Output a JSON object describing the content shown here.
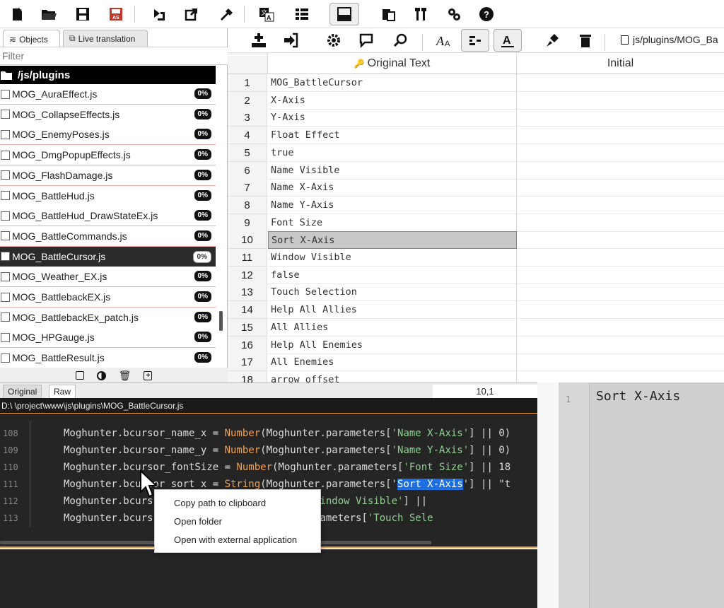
{
  "left_panel": {
    "tabs": [
      {
        "label": "Objects"
      },
      {
        "label": "Live translation"
      }
    ],
    "filter_placeholder": "Filter",
    "folder": "/js/plugins",
    "files": [
      {
        "name": "MOG_AuraEffect.js",
        "progress": "0%"
      },
      {
        "name": "MOG_CollapseEffects.js",
        "progress": "0%"
      },
      {
        "name": "MOG_EnemyPoses.js",
        "progress": "0%"
      },
      {
        "name": "MOG_DmgPopupEffects.js",
        "progress": "0%"
      },
      {
        "name": "MOG_FlashDamage.js",
        "progress": "0%"
      },
      {
        "name": "MOG_BattleHud.js",
        "progress": "0%"
      },
      {
        "name": "MOG_BattleHud_DrawStateEx.js",
        "progress": "0%"
      },
      {
        "name": "MOG_BattleCommands.js",
        "progress": "0%"
      },
      {
        "name": "MOG_BattleCursor.js",
        "progress": "0%",
        "selected": true
      },
      {
        "name": "MOG_Weather_EX.js",
        "progress": "0%"
      },
      {
        "name": "MOG_BattlebackEX.js",
        "progress": "0%"
      },
      {
        "name": "MOG_BattlebackEx_patch.js",
        "progress": "0%"
      },
      {
        "name": "MOG_HPGauge.js",
        "progress": "0%"
      },
      {
        "name": "MOG_BattleResult.js",
        "progress": "0%"
      }
    ]
  },
  "right_toolbar": {
    "path": "js/plugins/MOG_Ba"
  },
  "grid": {
    "columns": [
      "Original Text",
      "Initial"
    ],
    "rows": [
      {
        "n": "1",
        "text": "MOG_BattleCursor"
      },
      {
        "n": "2",
        "text": "X-Axis"
      },
      {
        "n": "3",
        "text": "Y-Axis"
      },
      {
        "n": "4",
        "text": "Float Effect"
      },
      {
        "n": "5",
        "text": "true"
      },
      {
        "n": "6",
        "text": "Name Visible"
      },
      {
        "n": "7",
        "text": "Name X-Axis"
      },
      {
        "n": "8",
        "text": "Name Y-Axis"
      },
      {
        "n": "9",
        "text": "Font Size"
      },
      {
        "n": "10",
        "text": "Sort X-Axis",
        "selected": true
      },
      {
        "n": "11",
        "text": "Window Visible"
      },
      {
        "n": "12",
        "text": "false"
      },
      {
        "n": "13",
        "text": "Touch Selection"
      },
      {
        "n": "14",
        "text": "Help All Allies"
      },
      {
        "n": "15",
        "text": "All Allies"
      },
      {
        "n": "16",
        "text": "Help All Enemies"
      },
      {
        "n": "17",
        "text": "All Enemies"
      },
      {
        "n": "18",
        "text": "arrow offset"
      }
    ]
  },
  "bottom": {
    "tabs": [
      "Original",
      "Raw"
    ],
    "position": "10,1",
    "path": "D:\\                              \\project\\www\\js\\plugins\\MOG_BattleCursor.js",
    "code_lines": [
      {
        "ln": "108",
        "pre": "Moghunter.bcursor_name_x = ",
        "fn": "Number",
        "mid": "(Moghunter.parameters[",
        "str": "'Name X-Axis'",
        "post": "] || 0)"
      },
      {
        "ln": "109",
        "pre": "Moghunter.bcursor_name_y = ",
        "fn": "Number",
        "mid": "(Moghunter.parameters[",
        "str": "'Name Y-Axis'",
        "post": "] || 0)"
      },
      {
        "ln": "110",
        "pre": "Moghunter.bcursor_fontSize = ",
        "fn": "Number",
        "mid": "(Moghunter.parameters[",
        "str": "'Font Size'",
        "post": "] || 18"
      },
      {
        "ln": "111",
        "pre": "Moghunter.bcursor_sort_x = ",
        "fn": "String",
        "mid": "(Moghunter.parameters['",
        "hl": "Sort X-Axis",
        "post": "'] || \"t"
      },
      {
        "ln": "112",
        "pre": "Moghunter.bcurs",
        "fn": "",
        "mid": "            er.parameters[",
        "str": "'Window Visible'",
        "post": "] ||"
      },
      {
        "ln": "113",
        "pre": "Moghunter.bcurs",
        "fn": "",
        "mid": "             g(Moghunter.parameters[",
        "str": "'Touch Sele",
        "post": ""
      }
    ],
    "right_line": "1",
    "right_text": "Sort X-Axis"
  },
  "context_menu": {
    "items": [
      "Copy path to clipboard",
      "Open folder",
      "Open with external application"
    ]
  }
}
